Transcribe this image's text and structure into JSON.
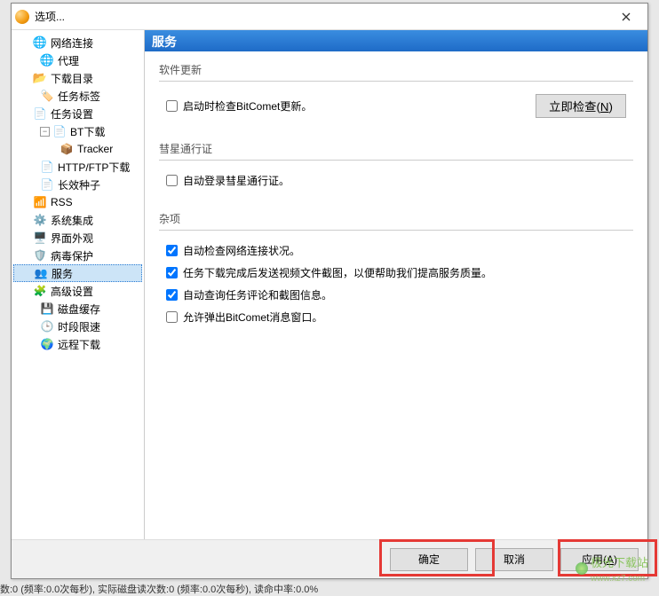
{
  "window": {
    "title": "选项..."
  },
  "sidebar": {
    "items": [
      {
        "label": "网络连接"
      },
      {
        "label": "代理"
      },
      {
        "label": "下载目录"
      },
      {
        "label": "任务标签"
      },
      {
        "label": "任务设置"
      },
      {
        "label": "BT下载"
      },
      {
        "label": "Tracker"
      },
      {
        "label": "HTTP/FTP下载"
      },
      {
        "label": "长效种子"
      },
      {
        "label": "RSS"
      },
      {
        "label": "系统集成"
      },
      {
        "label": "界面外观"
      },
      {
        "label": "病毒保护"
      },
      {
        "label": "服务"
      },
      {
        "label": "高级设置"
      },
      {
        "label": "磁盘缓存"
      },
      {
        "label": "时段限速"
      },
      {
        "label": "远程下载"
      }
    ]
  },
  "content": {
    "header": "服务",
    "groups": {
      "update": {
        "title": "软件更新",
        "check_on_start": {
          "label": "启动时检查BitComet更新。",
          "checked": false
        },
        "check_now": "立即检查(N)"
      },
      "passport": {
        "title": "彗星通行证",
        "auto_login": {
          "label": "自动登录彗星通行证。",
          "checked": false
        }
      },
      "misc": {
        "title": "杂项",
        "auto_net": {
          "label": "自动检查网络连接状况。",
          "checked": true
        },
        "send_thumb": {
          "label": "任务下载完成后发送视频文件截图，以便帮助我们提高服务质量。",
          "checked": true
        },
        "auto_query": {
          "label": "自动查询任务评论和截图信息。",
          "checked": true
        },
        "popup": {
          "label": "允许弹出BitComet消息窗口。",
          "checked": false
        }
      }
    }
  },
  "buttons": {
    "ok": "确定",
    "cancel": "取消",
    "apply": "应用(A)"
  },
  "watermark": {
    "text": "极光下载站",
    "url": "www.xz7.com"
  },
  "bg_status": "数:0 (频率:0.0次每秒), 实际磁盘读次数:0 (频率:0.0次每秒), 读命中率:0.0%"
}
